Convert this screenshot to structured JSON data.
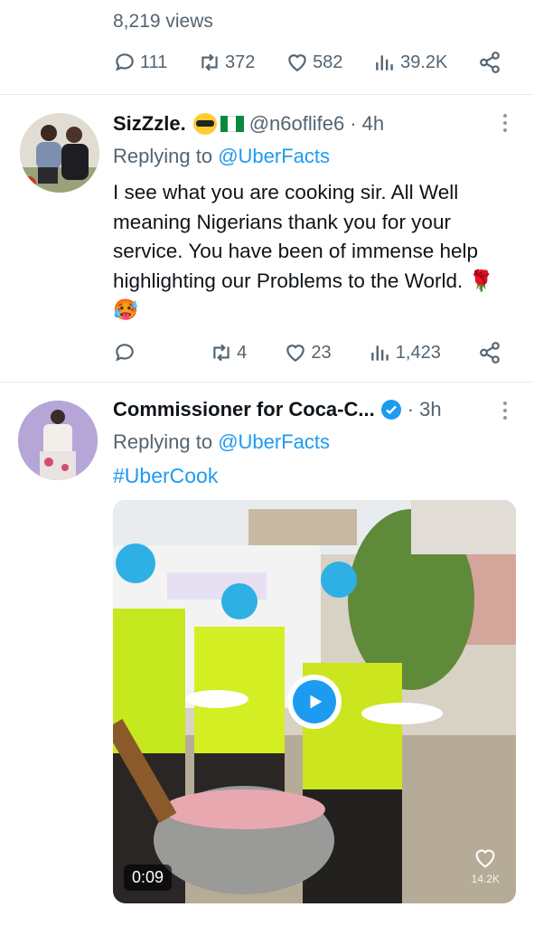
{
  "top_tweet": {
    "views": "8,219 views",
    "replies": "111",
    "retweets": "372",
    "likes": "582",
    "analytics": "39.2K"
  },
  "reply1": {
    "display_name": "SizZzle.",
    "handle": "@n6oflife6",
    "time": "· 4h",
    "replying_label": "Replying to ",
    "replying_to": "@UberFacts",
    "text": "I see what you are cooking sir. All Well meaning Nigerians thank you for your service. You have been of immense help highlighting our Problems to the World. 🌹🥵",
    "retweets": "4",
    "likes": "23",
    "analytics": "1,423"
  },
  "reply2": {
    "display_name": "Commissioner for Coca-C...",
    "time": "· 3h",
    "replying_label": "Replying to ",
    "replying_to": "@UberFacts",
    "hashtag": "#UberCook",
    "video_duration": "0:09",
    "video_likes": "14.2K"
  },
  "colors": {
    "accent": "#1d9bf0",
    "muted": "#536471",
    "text": "#0f1419"
  },
  "icons": [
    "reply-icon",
    "retweet-icon",
    "like-icon",
    "analytics-icon",
    "share-icon",
    "more-icon",
    "verified-icon",
    "play-icon"
  ]
}
